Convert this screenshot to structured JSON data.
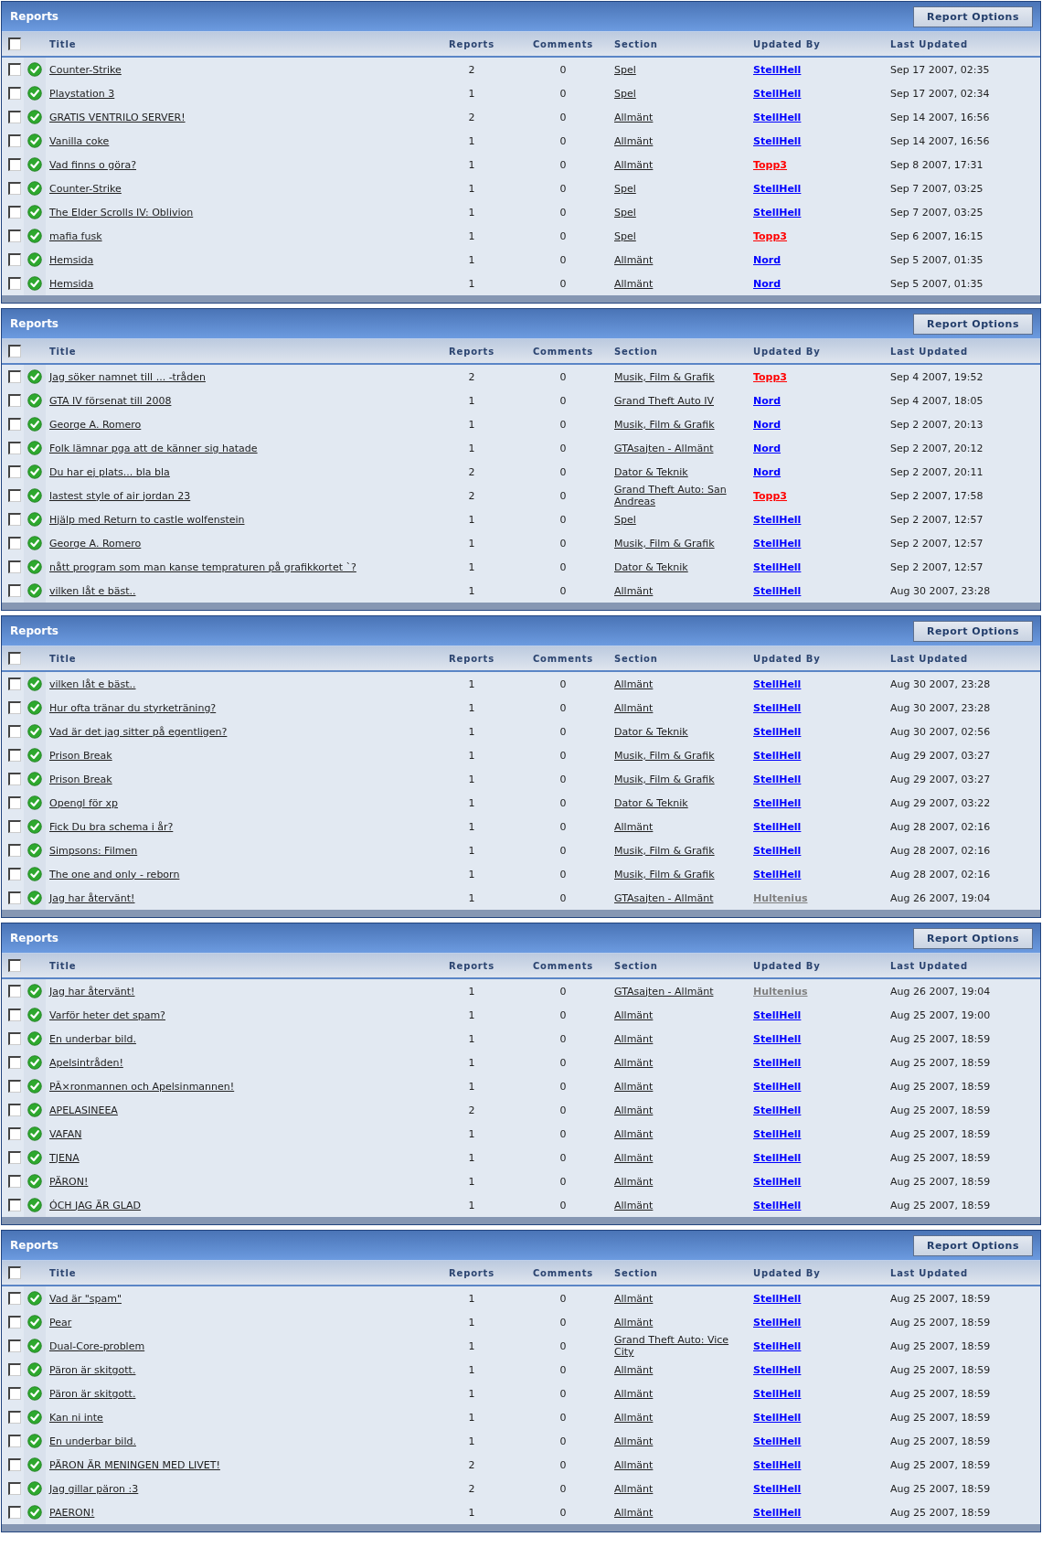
{
  "panels": [
    {
      "title": "Reports",
      "options_button": "Report Options",
      "select_all_checked": false,
      "columns": [
        "Title",
        "Reports",
        "Comments",
        "Section",
        "Updated By",
        "Last Updated"
      ],
      "rows": [
        {
          "checked": false,
          "title": "Counter-Strike",
          "reports": "2",
          "comments": "0",
          "section": "Spel",
          "updated_by": {
            "name": "StellHell",
            "color": "#0000ff"
          },
          "last_updated": "Sep 17 2007, 02:35"
        },
        {
          "checked": false,
          "title": "Playstation 3",
          "reports": "1",
          "comments": "0",
          "section": "Spel",
          "updated_by": {
            "name": "StellHell",
            "color": "#0000ff"
          },
          "last_updated": "Sep 17 2007, 02:34"
        },
        {
          "checked": false,
          "title": "GRATIS VENTRILO SERVER!",
          "reports": "2",
          "comments": "0",
          "section": "Allmänt",
          "updated_by": {
            "name": "StellHell",
            "color": "#0000ff"
          },
          "last_updated": "Sep 14 2007, 16:56"
        },
        {
          "checked": false,
          "title": "Vanilla coke",
          "reports": "1",
          "comments": "0",
          "section": "Allmänt",
          "updated_by": {
            "name": "StellHell",
            "color": "#0000ff"
          },
          "last_updated": "Sep 14 2007, 16:56"
        },
        {
          "checked": false,
          "title": "Vad finns o göra?",
          "reports": "1",
          "comments": "0",
          "section": "Allmänt",
          "updated_by": {
            "name": "Topp3",
            "color": "#ff0000"
          },
          "last_updated": "Sep 8 2007, 17:31"
        },
        {
          "checked": false,
          "title": "Counter-Strike",
          "reports": "1",
          "comments": "0",
          "section": "Spel",
          "updated_by": {
            "name": "StellHell",
            "color": "#0000ff"
          },
          "last_updated": "Sep 7 2007, 03:25"
        },
        {
          "checked": false,
          "title": "The Elder Scrolls IV: Oblivion",
          "reports": "1",
          "comments": "0",
          "section": "Spel",
          "updated_by": {
            "name": "StellHell",
            "color": "#0000ff"
          },
          "last_updated": "Sep 7 2007, 03:25"
        },
        {
          "checked": false,
          "title": "mafia fusk",
          "reports": "1",
          "comments": "0",
          "section": "Spel",
          "updated_by": {
            "name": "Topp3",
            "color": "#ff0000"
          },
          "last_updated": "Sep 6 2007, 16:15"
        },
        {
          "checked": false,
          "title": "Hemsida",
          "reports": "1",
          "comments": "0",
          "section": "Allmänt",
          "updated_by": {
            "name": "Nord",
            "color": "#0000ff"
          },
          "last_updated": "Sep 5 2007, 01:35"
        },
        {
          "checked": false,
          "title": "Hemsida",
          "reports": "1",
          "comments": "0",
          "section": "Allmänt",
          "updated_by": {
            "name": "Nord",
            "color": "#0000ff"
          },
          "last_updated": "Sep 5 2007, 01:35"
        }
      ]
    },
    {
      "title": "Reports",
      "options_button": "Report Options",
      "select_all_checked": false,
      "columns": [
        "Title",
        "Reports",
        "Comments",
        "Section",
        "Updated By",
        "Last Updated"
      ],
      "rows": [
        {
          "checked": false,
          "title": "Jag söker namnet till ... -tråden",
          "reports": "2",
          "comments": "0",
          "section": "Musik, Film & Grafik",
          "updated_by": {
            "name": "Topp3",
            "color": "#ff0000"
          },
          "last_updated": "Sep 4 2007, 19:52"
        },
        {
          "checked": false,
          "title": "GTA IV försenat till 2008",
          "reports": "1",
          "comments": "0",
          "section": "Grand Theft Auto IV",
          "updated_by": {
            "name": "Nord",
            "color": "#0000ff"
          },
          "last_updated": "Sep 4 2007, 18:05"
        },
        {
          "checked": false,
          "title": "George A. Romero",
          "reports": "1",
          "comments": "0",
          "section": "Musik, Film & Grafik",
          "updated_by": {
            "name": "Nord",
            "color": "#0000ff"
          },
          "last_updated": "Sep 2 2007, 20:13"
        },
        {
          "checked": false,
          "title": "Folk lämnar pga att de känner sig hatade",
          "reports": "1",
          "comments": "0",
          "section": "GTAsajten - Allmänt",
          "updated_by": {
            "name": "Nord",
            "color": "#0000ff"
          },
          "last_updated": "Sep 2 2007, 20:12"
        },
        {
          "checked": false,
          "title": "Du har ej plats... bla bla",
          "reports": "2",
          "comments": "0",
          "section": "Dator & Teknik",
          "updated_by": {
            "name": "Nord",
            "color": "#0000ff"
          },
          "last_updated": "Sep 2 2007, 20:11"
        },
        {
          "checked": false,
          "title": "lastest style of air jordan 23",
          "reports": "2",
          "comments": "0",
          "section": "Grand Theft Auto: San Andreas",
          "updated_by": {
            "name": "Topp3",
            "color": "#ff0000"
          },
          "last_updated": "Sep 2 2007, 17:58"
        },
        {
          "checked": false,
          "title": "Hjälp med Return to castle wolfenstein",
          "reports": "1",
          "comments": "0",
          "section": "Spel",
          "updated_by": {
            "name": "StellHell",
            "color": "#0000ff"
          },
          "last_updated": "Sep 2 2007, 12:57"
        },
        {
          "checked": false,
          "title": "George A. Romero",
          "reports": "1",
          "comments": "0",
          "section": "Musik, Film & Grafik",
          "updated_by": {
            "name": "StellHell",
            "color": "#0000ff"
          },
          "last_updated": "Sep 2 2007, 12:57"
        },
        {
          "checked": false,
          "title": "nått program som man kanse tempraturen på grafikkortet `?",
          "reports": "1",
          "comments": "0",
          "section": "Dator & Teknik",
          "updated_by": {
            "name": "StellHell",
            "color": "#0000ff"
          },
          "last_updated": "Sep 2 2007, 12:57"
        },
        {
          "checked": false,
          "title": "vilken låt e bäst..",
          "reports": "1",
          "comments": "0",
          "section": "Allmänt",
          "updated_by": {
            "name": "StellHell",
            "color": "#0000ff"
          },
          "last_updated": "Aug 30 2007, 23:28"
        }
      ]
    },
    {
      "title": "Reports",
      "options_button": "Report Options",
      "select_all_checked": false,
      "columns": [
        "Title",
        "Reports",
        "Comments",
        "Section",
        "Updated By",
        "Last Updated"
      ],
      "rows": [
        {
          "checked": false,
          "title": "vilken låt e bäst..",
          "reports": "1",
          "comments": "0",
          "section": "Allmänt",
          "updated_by": {
            "name": "StellHell",
            "color": "#0000ff"
          },
          "last_updated": "Aug 30 2007, 23:28"
        },
        {
          "checked": false,
          "title": "Hur ofta tränar du styrketräning?",
          "reports": "1",
          "comments": "0",
          "section": "Allmänt",
          "updated_by": {
            "name": "StellHell",
            "color": "#0000ff"
          },
          "last_updated": "Aug 30 2007, 23:28"
        },
        {
          "checked": false,
          "title": "Vad är det jag sitter på egentligen?",
          "reports": "1",
          "comments": "0",
          "section": "Dator & Teknik",
          "updated_by": {
            "name": "StellHell",
            "color": "#0000ff"
          },
          "last_updated": "Aug 30 2007, 02:56"
        },
        {
          "checked": false,
          "title": "Prison Break",
          "reports": "1",
          "comments": "0",
          "section": "Musik, Film & Grafik",
          "updated_by": {
            "name": "StellHell",
            "color": "#0000ff"
          },
          "last_updated": "Aug 29 2007, 03:27"
        },
        {
          "checked": false,
          "title": "Prison Break",
          "reports": "1",
          "comments": "0",
          "section": "Musik, Film & Grafik",
          "updated_by": {
            "name": "StellHell",
            "color": "#0000ff"
          },
          "last_updated": "Aug 29 2007, 03:27"
        },
        {
          "checked": false,
          "title": "Opengl för xp",
          "reports": "1",
          "comments": "0",
          "section": "Dator & Teknik",
          "updated_by": {
            "name": "StellHell",
            "color": "#0000ff"
          },
          "last_updated": "Aug 29 2007, 03:22"
        },
        {
          "checked": false,
          "title": "Fick Du bra schema i år?",
          "reports": "1",
          "comments": "0",
          "section": "Allmänt",
          "updated_by": {
            "name": "StellHell",
            "color": "#0000ff"
          },
          "last_updated": "Aug 28 2007, 02:16"
        },
        {
          "checked": false,
          "title": "Simpsons: Filmen",
          "reports": "1",
          "comments": "0",
          "section": "Musik, Film & Grafik",
          "updated_by": {
            "name": "StellHell",
            "color": "#0000ff"
          },
          "last_updated": "Aug 28 2007, 02:16"
        },
        {
          "checked": false,
          "title": "The one and only - reborn",
          "reports": "1",
          "comments": "0",
          "section": "Musik, Film & Grafik",
          "updated_by": {
            "name": "StellHell",
            "color": "#0000ff"
          },
          "last_updated": "Aug 28 2007, 02:16"
        },
        {
          "checked": false,
          "title": "Jag har återvänt!",
          "reports": "1",
          "comments": "0",
          "section": "GTAsajten - Allmänt",
          "updated_by": {
            "name": "Hultenius",
            "color": "#808080"
          },
          "last_updated": "Aug 26 2007, 19:04"
        }
      ]
    },
    {
      "title": "Reports",
      "options_button": "Report Options",
      "select_all_checked": false,
      "columns": [
        "Title",
        "Reports",
        "Comments",
        "Section",
        "Updated By",
        "Last Updated"
      ],
      "rows": [
        {
          "checked": false,
          "title": "Jag har återvänt!",
          "reports": "1",
          "comments": "0",
          "section": "GTAsajten - Allmänt",
          "updated_by": {
            "name": "Hultenius",
            "color": "#808080"
          },
          "last_updated": "Aug 26 2007, 19:04"
        },
        {
          "checked": false,
          "title": "Varför heter det spam?",
          "reports": "1",
          "comments": "0",
          "section": "Allmänt",
          "updated_by": {
            "name": "StellHell",
            "color": "#0000ff"
          },
          "last_updated": "Aug 25 2007, 19:00"
        },
        {
          "checked": false,
          "title": "En underbar bild.",
          "reports": "1",
          "comments": "0",
          "section": "Allmänt",
          "updated_by": {
            "name": "StellHell",
            "color": "#0000ff"
          },
          "last_updated": "Aug 25 2007, 18:59"
        },
        {
          "checked": false,
          "title": "Apelsintråden!",
          "reports": "1",
          "comments": "0",
          "section": "Allmänt",
          "updated_by": {
            "name": "StellHell",
            "color": "#0000ff"
          },
          "last_updated": "Aug 25 2007, 18:59"
        },
        {
          "checked": false,
          "title": "PÃ×ronmannen och Apelsinmannen!",
          "reports": "1",
          "comments": "0",
          "section": "Allmänt",
          "updated_by": {
            "name": "StellHell",
            "color": "#0000ff"
          },
          "last_updated": "Aug 25 2007, 18:59"
        },
        {
          "checked": false,
          "title": "APELASINEEA",
          "reports": "2",
          "comments": "0",
          "section": "Allmänt",
          "updated_by": {
            "name": "StellHell",
            "color": "#0000ff"
          },
          "last_updated": "Aug 25 2007, 18:59"
        },
        {
          "checked": false,
          "title": "VAFAN",
          "reports": "1",
          "comments": "0",
          "section": "Allmänt",
          "updated_by": {
            "name": "StellHell",
            "color": "#0000ff"
          },
          "last_updated": "Aug 25 2007, 18:59"
        },
        {
          "checked": false,
          "title": "TJENA",
          "reports": "1",
          "comments": "0",
          "section": "Allmänt",
          "updated_by": {
            "name": "StellHell",
            "color": "#0000ff"
          },
          "last_updated": "Aug 25 2007, 18:59"
        },
        {
          "checked": false,
          "title": "PÄRON!",
          "reports": "1",
          "comments": "0",
          "section": "Allmänt",
          "updated_by": {
            "name": "StellHell",
            "color": "#0000ff"
          },
          "last_updated": "Aug 25 2007, 18:59"
        },
        {
          "checked": false,
          "title": "ÓCH JAG ÄR GLAD",
          "reports": "1",
          "comments": "0",
          "section": "Allmänt",
          "updated_by": {
            "name": "StellHell",
            "color": "#0000ff"
          },
          "last_updated": "Aug 25 2007, 18:59"
        }
      ]
    },
    {
      "title": "Reports",
      "options_button": "Report Options",
      "select_all_checked": false,
      "columns": [
        "Title",
        "Reports",
        "Comments",
        "Section",
        "Updated By",
        "Last Updated"
      ],
      "rows": [
        {
          "checked": false,
          "title": "Vad är \"spam\"",
          "reports": "1",
          "comments": "0",
          "section": "Allmänt",
          "updated_by": {
            "name": "StellHell",
            "color": "#0000ff"
          },
          "last_updated": "Aug 25 2007, 18:59"
        },
        {
          "checked": false,
          "title": "Pear",
          "reports": "1",
          "comments": "0",
          "section": "Allmänt",
          "updated_by": {
            "name": "StellHell",
            "color": "#0000ff"
          },
          "last_updated": "Aug 25 2007, 18:59"
        },
        {
          "checked": false,
          "title": "Dual-Core-problem",
          "reports": "1",
          "comments": "0",
          "section": "Grand Theft Auto: Vice City",
          "updated_by": {
            "name": "StellHell",
            "color": "#0000ff"
          },
          "last_updated": "Aug 25 2007, 18:59"
        },
        {
          "checked": false,
          "title": "Päron är skitgott.",
          "reports": "1",
          "comments": "0",
          "section": "Allmänt",
          "updated_by": {
            "name": "StellHell",
            "color": "#0000ff"
          },
          "last_updated": "Aug 25 2007, 18:59"
        },
        {
          "checked": false,
          "title": "Päron är skitgott.",
          "reports": "1",
          "comments": "0",
          "section": "Allmänt",
          "updated_by": {
            "name": "StellHell",
            "color": "#0000ff"
          },
          "last_updated": "Aug 25 2007, 18:59"
        },
        {
          "checked": false,
          "title": "Kan ni inte",
          "reports": "1",
          "comments": "0",
          "section": "Allmänt",
          "updated_by": {
            "name": "StellHell",
            "color": "#0000ff"
          },
          "last_updated": "Aug 25 2007, 18:59"
        },
        {
          "checked": false,
          "title": "En underbar bild.",
          "reports": "1",
          "comments": "0",
          "section": "Allmänt",
          "updated_by": {
            "name": "StellHell",
            "color": "#0000ff"
          },
          "last_updated": "Aug 25 2007, 18:59"
        },
        {
          "checked": false,
          "title": "PÄRON ÄR MENINGEN MED LIVET!",
          "reports": "2",
          "comments": "0",
          "section": "Allmänt",
          "updated_by": {
            "name": "StellHell",
            "color": "#0000ff"
          },
          "last_updated": "Aug 25 2007, 18:59"
        },
        {
          "checked": false,
          "title": "Jag gillar päron :3",
          "reports": "2",
          "comments": "0",
          "section": "Allmänt",
          "updated_by": {
            "name": "StellHell",
            "color": "#0000ff"
          },
          "last_updated": "Aug 25 2007, 18:59"
        },
        {
          "checked": false,
          "title": "PAERON!",
          "reports": "1",
          "comments": "0",
          "section": "Allmänt",
          "updated_by": {
            "name": "StellHell",
            "color": "#0000ff"
          },
          "last_updated": "Aug 25 2007, 18:59"
        }
      ]
    }
  ]
}
